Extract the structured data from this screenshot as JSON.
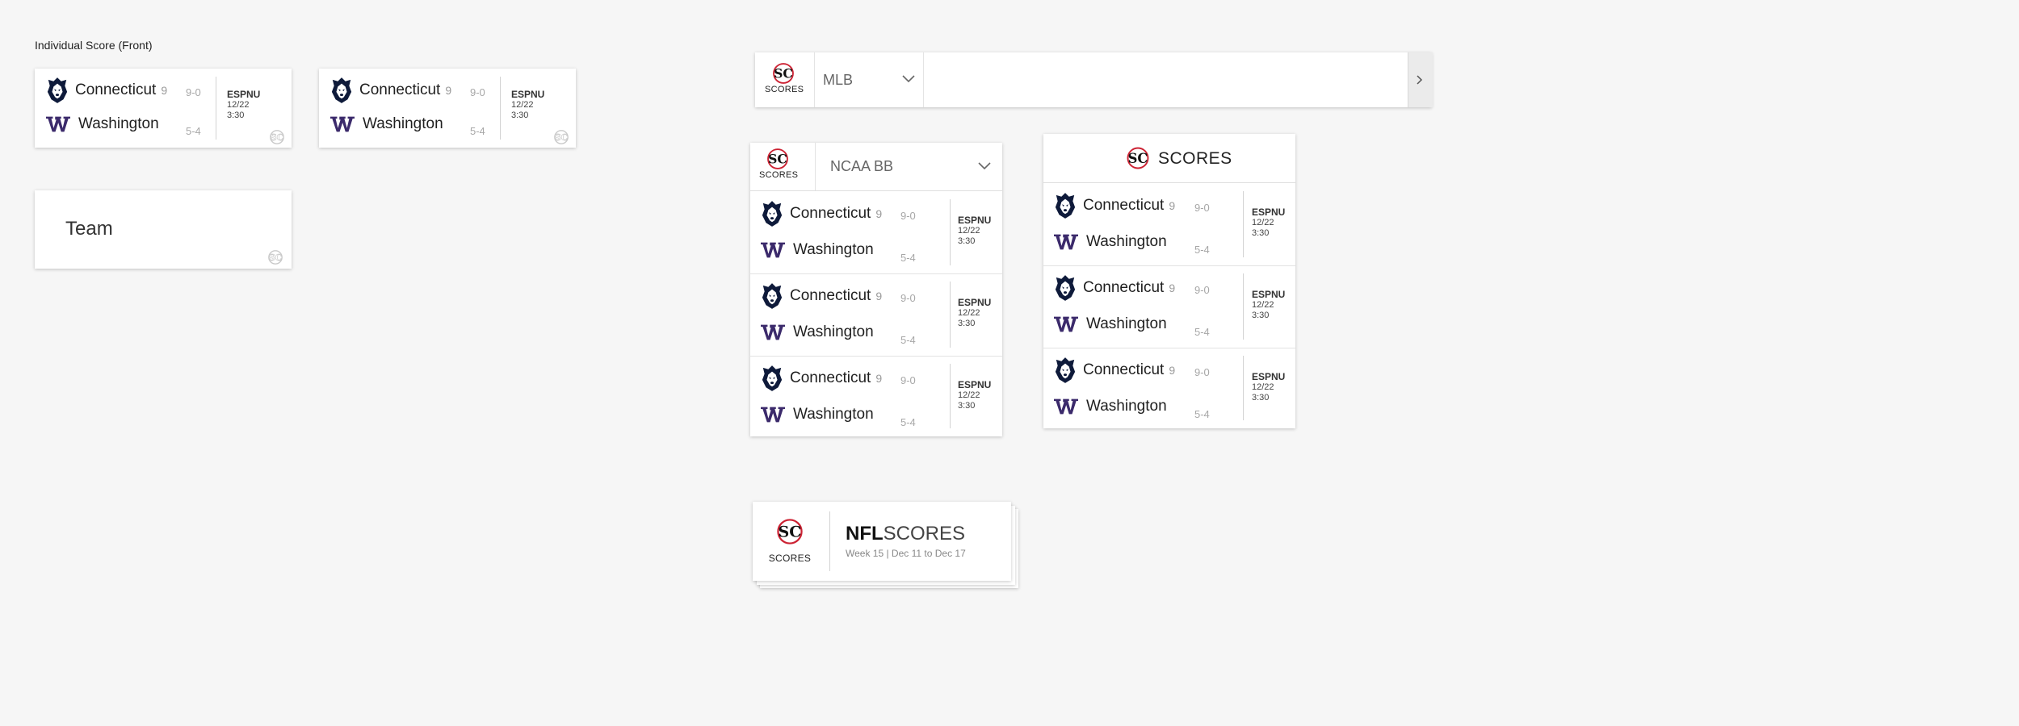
{
  "section_title": "Individual Score (Front)",
  "games": [
    {
      "home": {
        "name": "Connecticut",
        "seed": "9",
        "record": "9-0"
      },
      "away": {
        "name": "Washington",
        "record": "5-4"
      },
      "network": "ESPNU",
      "date": "12/22",
      "time": "3:30"
    }
  ],
  "team_card": {
    "label": "Team"
  },
  "mlb_bar": {
    "logo_caption": "SCORES",
    "league": "MLB"
  },
  "ncaa_panel": {
    "logo_caption": "SCORES",
    "league": "NCAA BB"
  },
  "scores_panel": {
    "header": "SCORES"
  },
  "nfl_card": {
    "logo_caption": "SCORES",
    "league": "NFL",
    "title": "SCORES",
    "subtitle": "Week 15 | Dec 11 to Dec 17"
  },
  "colors": {
    "uconn_navy": "#0e1a3a",
    "washington_purple": "#3b2a6b",
    "sc_red": "#cc2233",
    "background": "#f6f6f6"
  }
}
